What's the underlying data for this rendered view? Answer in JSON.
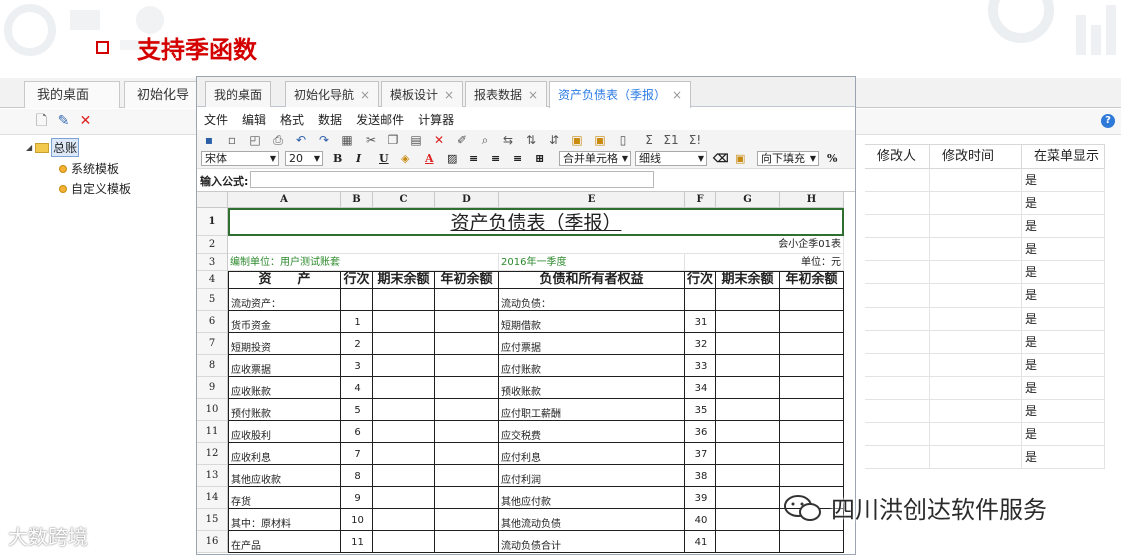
{
  "slide": {
    "heading": "支持季函数"
  },
  "background_app": {
    "tabs": [
      "我的桌面",
      "初始化导航"
    ],
    "grid_headers": [
      "修改人",
      "修改时间",
      "在菜单显示"
    ],
    "grid_rows": [
      "是",
      "是",
      "是",
      "是",
      "是",
      "是",
      "是",
      "是",
      "是",
      "是",
      "是",
      "是",
      "是"
    ],
    "tree": {
      "root": "总账",
      "children": [
        "系统模板",
        "自定义模板"
      ]
    },
    "help_glyph": "?"
  },
  "window": {
    "tabs": [
      {
        "label": "我的桌面",
        "closable": false
      },
      {
        "label": "初始化导航",
        "closable": true
      },
      {
        "label": "模板设计",
        "closable": true
      },
      {
        "label": "报表数据",
        "closable": true
      },
      {
        "label": "资产负债表（季报）",
        "closable": true,
        "active": true
      }
    ],
    "close_glyph": "×",
    "menus": [
      "文件",
      "编辑",
      "格式",
      "数据",
      "发送邮件",
      "计算器"
    ],
    "toolbar": {
      "font": "宋体",
      "size": "20",
      "bold": "B",
      "italic": "I",
      "underline": "U",
      "merge": "合并单元格",
      "border": "细线",
      "fill": "向下填充",
      "percent": "%",
      "sigma1": "Σ",
      "sigma2": "Σ1",
      "sigma3": "Σ!"
    },
    "formula_label": "输入公式:",
    "formula_value": ""
  },
  "sheet": {
    "columns": [
      "A",
      "B",
      "C",
      "D",
      "E",
      "F",
      "G",
      "H"
    ],
    "title": "资产负债表（季报）",
    "form_code": "会小企季01表",
    "unit_left": "编制单位：用户测试账套",
    "period": "2016年一季度",
    "unit_right": "单位：元",
    "headers": [
      "资　　产",
      "行次",
      "期末余额",
      "年初余额",
      "负债和所有者权益",
      "行次",
      "期末余额",
      "年初余额"
    ],
    "rows": [
      {
        "n": "5",
        "a": "流动资产：",
        "b": "",
        "e": "流动负债：",
        "f": ""
      },
      {
        "n": "6",
        "a": "货币资金",
        "b": "1",
        "e": "短期借款",
        "f": "31"
      },
      {
        "n": "7",
        "a": "短期投资",
        "b": "2",
        "e": "应付票据",
        "f": "32"
      },
      {
        "n": "8",
        "a": "应收票据",
        "b": "3",
        "e": "应付账款",
        "f": "33"
      },
      {
        "n": "9",
        "a": "应收账款",
        "b": "4",
        "e": "预收账款",
        "f": "34"
      },
      {
        "n": "10",
        "a": "预付账款",
        "b": "5",
        "e": "应付职工薪酬",
        "f": "35"
      },
      {
        "n": "11",
        "a": "应收股利",
        "b": "6",
        "e": "应交税费",
        "f": "36"
      },
      {
        "n": "12",
        "a": "应收利息",
        "b": "7",
        "e": "应付利息",
        "f": "37"
      },
      {
        "n": "13",
        "a": "其他应收款",
        "b": "8",
        "e": "应付利润",
        "f": "38"
      },
      {
        "n": "14",
        "a": "存货",
        "b": "9",
        "e": "其他应付款",
        "f": "39"
      },
      {
        "n": "15",
        "a": "其中：原材料",
        "b": "10",
        "e": "其他流动负债",
        "f": "40"
      },
      {
        "n": "16",
        "a": "在产品",
        "b": "11",
        "e": "流动负债合计",
        "f": "41"
      }
    ],
    "row_numbers_top": [
      "1",
      "2",
      "3",
      "4"
    ]
  },
  "watermarks": {
    "left": "大数跨境",
    "right": "四川洪创达软件服务"
  }
}
